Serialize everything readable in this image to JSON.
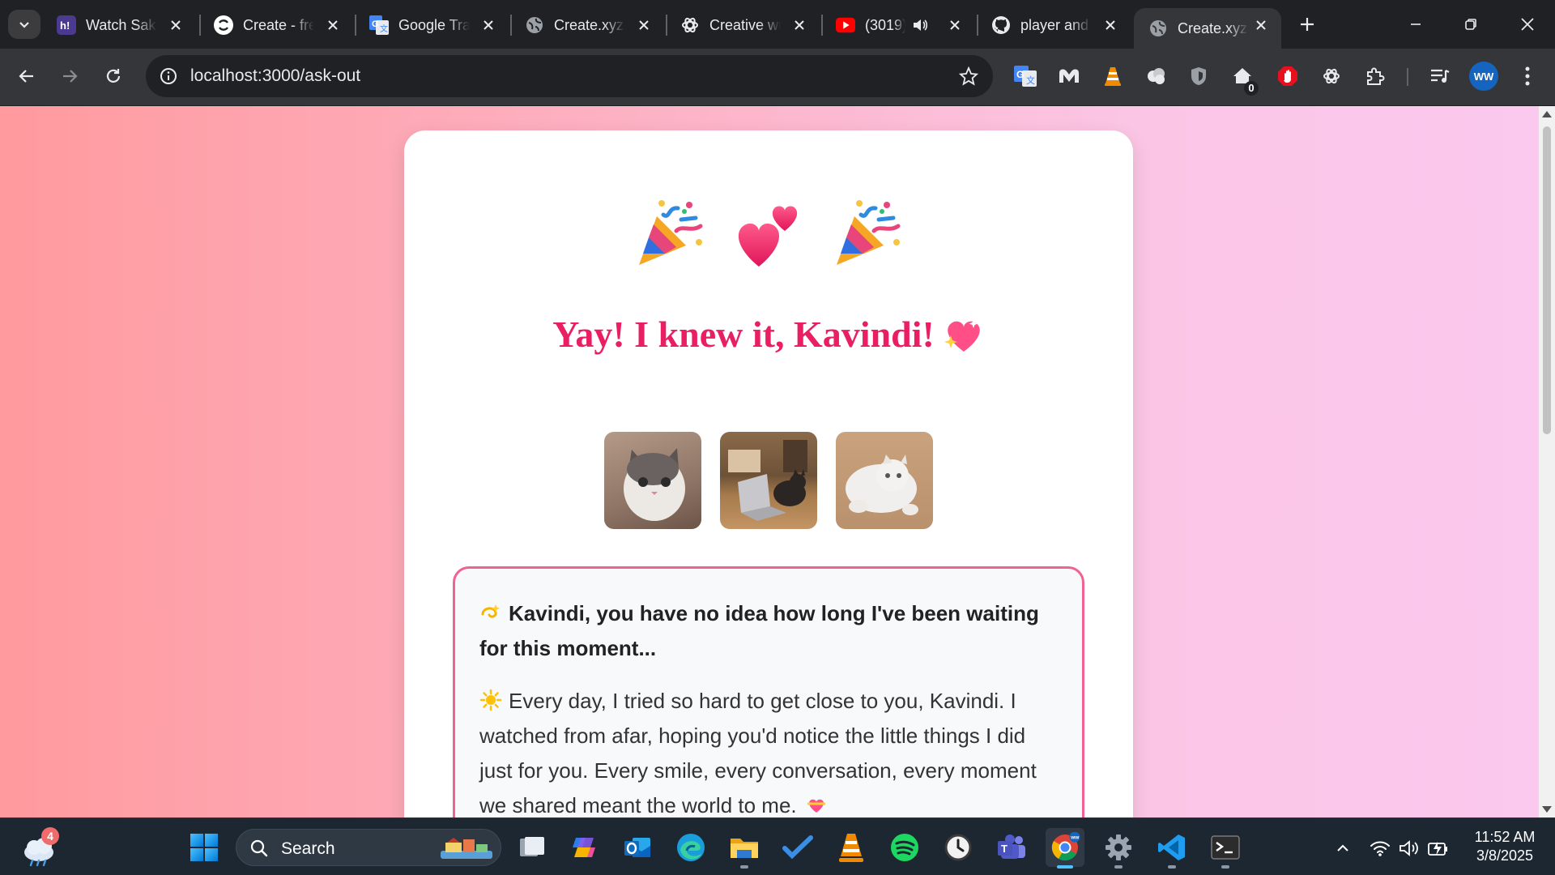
{
  "browser": {
    "tabs": [
      {
        "title": "Watch Sakamoto Days",
        "favicon": "hianime-icon"
      },
      {
        "title": "Create - free",
        "favicon": "create-icon"
      },
      {
        "title": "Google Translate",
        "favicon": "google-translate-icon"
      },
      {
        "title": "Create.xyz",
        "favicon": "globe-icon"
      },
      {
        "title": "Creative writing",
        "favicon": "chatgpt-icon"
      },
      {
        "title": "(3019)",
        "favicon": "youtube-icon",
        "audio": true
      },
      {
        "title": "player and",
        "favicon": "github-icon"
      },
      {
        "title": "Create.xyz",
        "favicon": "globe-icon",
        "active": true
      }
    ],
    "url": "localhost:3000/ask-out",
    "extensions": [
      "google-translate-icon",
      "malwarebytes-icon",
      "vlc-icon",
      "ext-puzzle-cloud-icon",
      "shield-icon",
      "home-badge-icon",
      "adblock-icon",
      "chatgpt-icon",
      "extensions-icon",
      "media-control-icon"
    ],
    "home_badge_count": "0",
    "profile_initials": "WW"
  },
  "page": {
    "heading": "Yay! I knew it, Kavindi!",
    "message": {
      "lead": "Kavindi, you have no idea how long I've been waiting for this moment...",
      "body": "Every day, I tried so hard to get close to you, Kavindi. I watched from afar, hoping you'd notice the little things I did just for you. Every smile, every conversation, every moment we shared meant the world to me."
    },
    "colors": {
      "accent": "#e91e63",
      "border": "#f06292",
      "gradient_start": "#ff9a9e",
      "gradient_end": "#fbc8ee"
    }
  },
  "taskbar": {
    "search_label": "Search",
    "weather_badge": "4",
    "apps": [
      "windows-start-icon",
      "task-view-icon",
      "copilot-icon",
      "outlook-icon",
      "edge-icon",
      "file-explorer-icon",
      "todo-icon",
      "vlc-icon",
      "spotify-icon",
      "clock-icon",
      "teams-icon",
      "chrome-icon",
      "settings-icon",
      "vscode-icon",
      "terminal-icon"
    ],
    "time": "11:52 AM",
    "date": "3/8/2025"
  }
}
